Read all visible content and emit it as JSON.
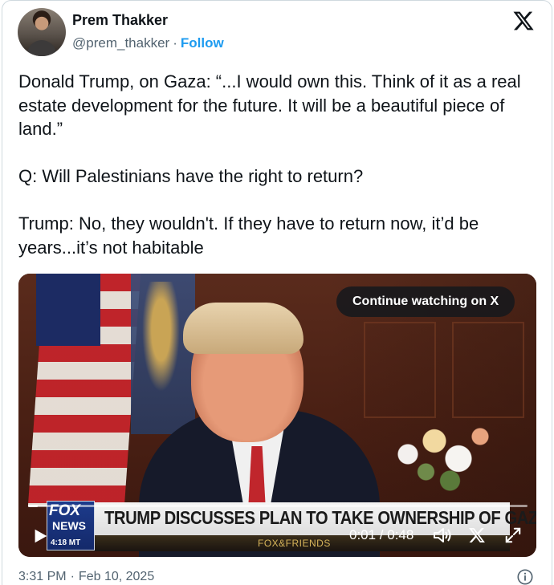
{
  "author": {
    "display_name": "Prem Thakker",
    "handle": "@prem_thakker",
    "separator": "·",
    "follow_label": "Follow",
    "avatar_icon": "profile-photo"
  },
  "header": {
    "logo_icon": "x-logo-icon"
  },
  "tweet": {
    "text": "Donald Trump, on Gaza: “...I would own this. Think of it as a real estate development for the future. It will be a beautiful piece of land.”\n\nQ: Will Palestinians have the right to return?\n\nTrump: No, they wouldn't. If they have to return now, it’d be years...it’s not habitable"
  },
  "media": {
    "continue_label": "Continue watching on X",
    "chyron": "TRUMP DISCUSSES PLAN TO TAKE OWNERSHIP OF GAZA",
    "chyron_sub": "FOX&FRIENDS",
    "network_word": "FOX",
    "network_sub": "NEWS",
    "network_time": "4:18 MT",
    "time": "0:01 / 0:48",
    "progress_fraction": 0.02,
    "icons": [
      "play-icon",
      "volume-icon",
      "x-logo-icon",
      "expand-icon"
    ]
  },
  "footer": {
    "time": "3:31 PM",
    "separator": "·",
    "date": "Feb 10, 2025",
    "info_icon": "info-icon"
  },
  "colors": {
    "accent": "#1d9bf0",
    "text": "#0f1419",
    "muted": "#536471",
    "border": "#cfd9de"
  }
}
